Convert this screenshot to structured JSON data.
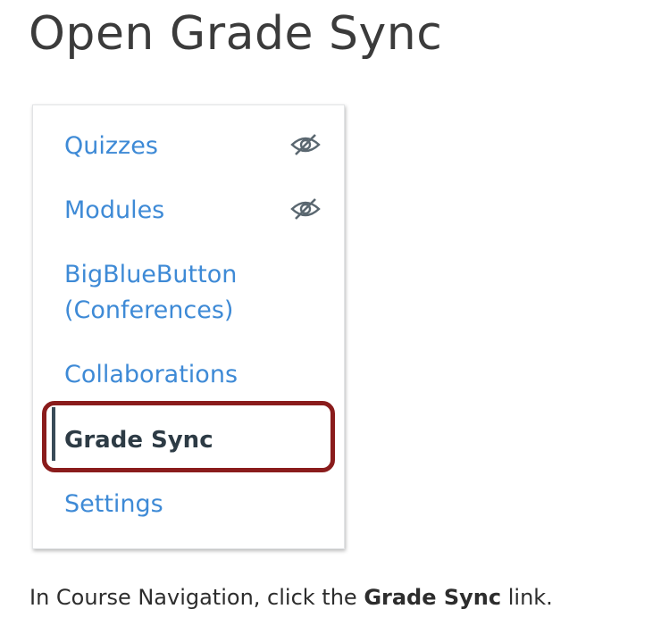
{
  "page": {
    "title": "Open Grade Sync"
  },
  "course_nav": {
    "items": [
      {
        "label": "Quizzes",
        "hidden_icon": "eye-slash-icon"
      },
      {
        "label": "Modules",
        "hidden_icon": "eye-slash-icon"
      },
      {
        "label_line1": "BigBlueButton",
        "label_line2": "(Conferences)"
      },
      {
        "label": "Collaborations"
      },
      {
        "label": "Grade Sync",
        "active": true,
        "highlighted": true
      },
      {
        "label": "Settings"
      }
    ]
  },
  "instruction": {
    "before": "In Course Navigation, click the ",
    "emphasis": "Grade Sync",
    "after": " link."
  },
  "colors": {
    "link": "#3e8ad6",
    "active_text": "#2d3b45",
    "highlight_border": "#8a1c1c",
    "title_text": "#3b3b3b"
  }
}
